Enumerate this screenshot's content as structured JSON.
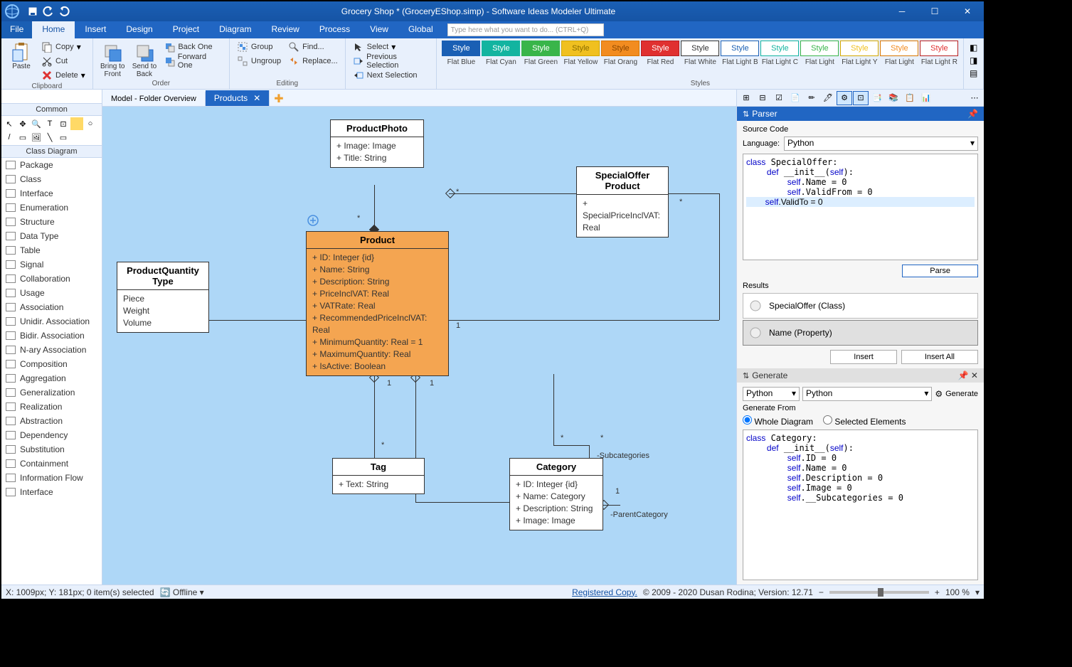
{
  "title": "Grocery Shop * (GroceryEShop.simp)  - Software Ideas Modeler Ultimate",
  "menu": {
    "file": "File",
    "home": "Home",
    "insert": "Insert",
    "design": "Design",
    "project": "Project",
    "diagram": "Diagram",
    "review": "Review",
    "process": "Process",
    "view": "View",
    "global": "Global",
    "search": "Type here what you want to do... (CTRL+Q)"
  },
  "ribbon": {
    "paste": "Paste",
    "copy": "Copy",
    "cut": "Cut",
    "delete": "Delete",
    "clipboard": "Clipboard",
    "bringfront": "Bring to Front",
    "sendback": "Send to Back",
    "backone": "Back One",
    "forwardone": "Forward One",
    "order": "Order",
    "group": "Group",
    "ungroup": "Ungroup",
    "find": "Find...",
    "replace": "Replace...",
    "editing": "Editing",
    "select": "Select",
    "prevsel": "Previous Selection",
    "nextsel": "Next Selection",
    "styles": "Styles",
    "style": "Style",
    "styleNames": [
      "Flat Blue",
      "Flat Cyan",
      "Flat Green",
      "Flat Yellow",
      "Flat Orang",
      "Flat Red",
      "Flat White",
      "Flat Light B",
      "Flat Light C",
      "Flat Light",
      "Flat Light Y",
      "Flat Light",
      "Flat Light R"
    ]
  },
  "sidebar": {
    "common": "Common",
    "classdiag": "Class Diagram",
    "items": [
      "Package",
      "Class",
      "Interface",
      "Enumeration",
      "Structure",
      "Data Type",
      "Table",
      "Signal",
      "Collaboration",
      "Usage",
      "Association",
      "Unidir. Association",
      "Bidir. Association",
      "N-ary Association",
      "Composition",
      "Aggregation",
      "Generalization",
      "Realization",
      "Abstraction",
      "Dependency",
      "Substitution",
      "Containment",
      "Information Flow",
      "Interface"
    ]
  },
  "tabs": {
    "model": "Model - Folder Overview",
    "products": "Products"
  },
  "diagram": {
    "productPhoto": {
      "name": "ProductPhoto",
      "attrs": [
        "+ Image: Image",
        "+ Title: String"
      ]
    },
    "productQtyType": {
      "name": "ProductQuantity Type",
      "attrs": [
        "Piece",
        "Weight",
        "Volume"
      ]
    },
    "product": {
      "name": "Product",
      "attrs": [
        "+ ID: Integer {id}",
        "+ Name: String",
        "+ Description: String",
        "+ PriceInclVAT: Real",
        "+ VATRate: Real",
        "+ RecommendedPriceInclVAT: Real",
        "+ MinimumQuantity: Real = 1",
        "+ MaximumQuantity: Real",
        "+ IsActive: Boolean"
      ]
    },
    "specialOffer": {
      "name": "SpecialOffer Product",
      "attrs": [
        "+ SpecialPriceInclVAT: Real"
      ]
    },
    "tag": {
      "name": "Tag",
      "attrs": [
        "+ Text: String"
      ]
    },
    "category": {
      "name": "Category",
      "attrs": [
        "+ ID: Integer {id}",
        "+ Name: Category",
        "+ Description: String",
        "+ Image: Image"
      ]
    },
    "labels": {
      "star": "*",
      "one": "1",
      "subcats": "-Subcategories",
      "parentcat": "-ParentCategory"
    }
  },
  "parser": {
    "title": "Parser",
    "sourceCode": "Source Code",
    "language": "Language:",
    "langValue": "Python",
    "code": "class SpecialOffer:\n    def __init__(self):\n        self.Name = 0\n        self.ValidFrom = 0\n        self.ValidTo = 0",
    "parse": "Parse",
    "results": "Results",
    "result1": "SpecialOffer (Class)",
    "result2": "Name (Property)",
    "insert": "Insert",
    "insertAll": "Insert All"
  },
  "generate": {
    "title": "Generate",
    "lang": "Python",
    "generateBtn": "Generate",
    "from": "Generate From",
    "whole": "Whole Diagram",
    "selected": "Selected Elements",
    "code": "class Category:\n    def __init__(self):\n        self.ID = 0\n        self.Name = 0\n        self.Description = 0\n        self.Image = 0\n        self.__Subcategories = 0"
  },
  "status": {
    "pos": "X: 1009px; Y: 181px; 0 item(s) selected",
    "offline": "Offline",
    "reg": "Registered Copy.",
    "ver": "© 2009 - 2020 Dusan Rodina; Version: 12.71",
    "zoom": "100 %"
  }
}
